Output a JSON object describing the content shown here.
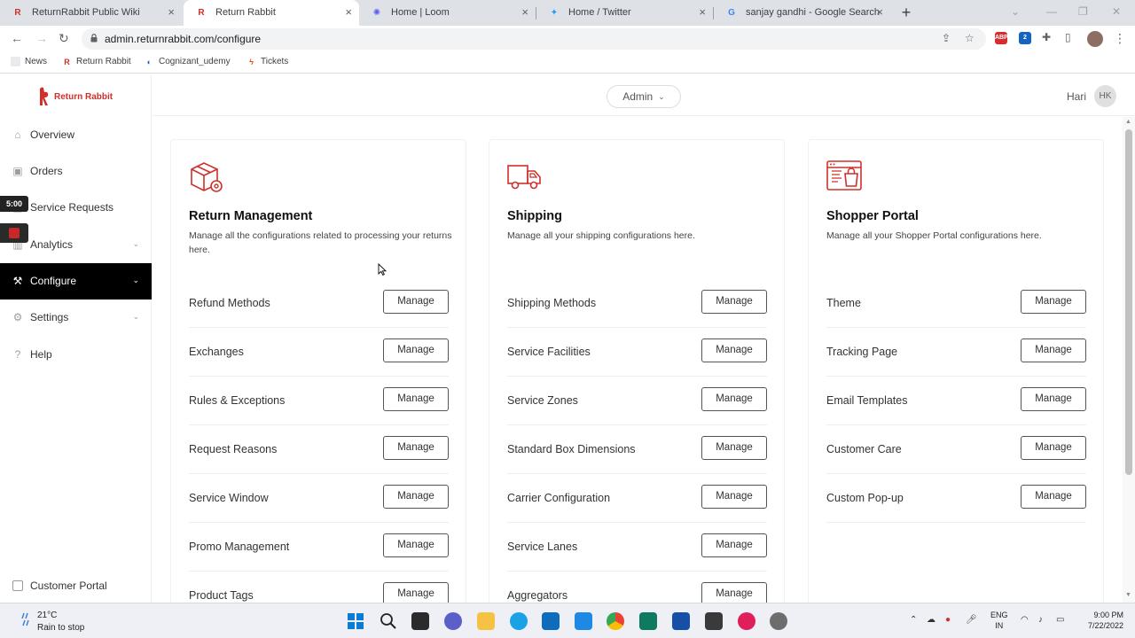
{
  "browser": {
    "tabs": [
      {
        "label": "ReturnRabbit Public Wiki",
        "favicon": "returnrabbit-favicon",
        "active": false
      },
      {
        "label": "Return Rabbit",
        "favicon": "returnrabbit-favicon",
        "active": true
      },
      {
        "label": "Home | Loom",
        "favicon": "loom-favicon",
        "active": false
      },
      {
        "label": "Home / Twitter",
        "favicon": "twitter-favicon",
        "active": false
      },
      {
        "label": "sanjay gandhi - Google Search",
        "favicon": "google-favicon",
        "active": false
      }
    ],
    "url": "admin.returnrabbit.com/configure",
    "bookmarks": [
      "News",
      "Return Rabbit",
      "Cognizant_udemy",
      "Tickets"
    ],
    "extension_badge": "ABP",
    "extension_count": "2"
  },
  "app": {
    "logo_text": "Return Rabbit",
    "sidebar": {
      "items": [
        {
          "label": "Overview",
          "icon": "home-icon",
          "active": false,
          "expandable": false
        },
        {
          "label": "Orders",
          "icon": "box-icon",
          "active": false,
          "expandable": false
        },
        {
          "label": "Service Requests",
          "icon": "clipboard-icon",
          "active": false,
          "expandable": false
        },
        {
          "label": "Analytics",
          "icon": "chart-icon",
          "active": false,
          "expandable": true
        },
        {
          "label": "Configure",
          "icon": "wrench-icon",
          "active": true,
          "expandable": true
        },
        {
          "label": "Settings",
          "icon": "gear-icon",
          "active": false,
          "expandable": true
        },
        {
          "label": "Help",
          "icon": "help-icon",
          "active": false,
          "expandable": false
        }
      ],
      "timer": "5:00",
      "customer_portal_label": "Customer Portal"
    },
    "header": {
      "role": "Admin",
      "user_name": "Hari",
      "user_initials": "HK"
    },
    "cards": [
      {
        "title": "Return Management",
        "description": "Manage all the configurations related to processing your returns here.",
        "icon": "box-gear-icon",
        "rows": [
          "Refund Methods",
          "Exchanges",
          "Rules & Exceptions",
          "Request Reasons",
          "Service Window",
          "Promo Management",
          "Product Tags"
        ]
      },
      {
        "title": "Shipping",
        "description": "Manage all your shipping configurations here.",
        "icon": "truck-icon",
        "rows": [
          "Shipping Methods",
          "Service Facilities",
          "Service Zones",
          "Standard Box Dimensions",
          "Carrier Configuration",
          "Service Lanes",
          "Aggregators"
        ]
      },
      {
        "title": "Shopper Portal",
        "description": "Manage all your Shopper Portal configurations here.",
        "icon": "shopping-bag-icon",
        "rows": [
          "Theme",
          "Tracking Page",
          "Email Templates",
          "Customer Care",
          "Custom Pop-up"
        ]
      }
    ],
    "manage_label": "Manage"
  },
  "taskbar": {
    "temperature": "21°C",
    "weather": "Rain to stop",
    "lang_1": "ENG",
    "lang_2": "IN",
    "time": "9:00 PM",
    "date": "7/22/2022"
  },
  "colors": {
    "brand": "#d0302a",
    "active_nav": "#000000"
  }
}
